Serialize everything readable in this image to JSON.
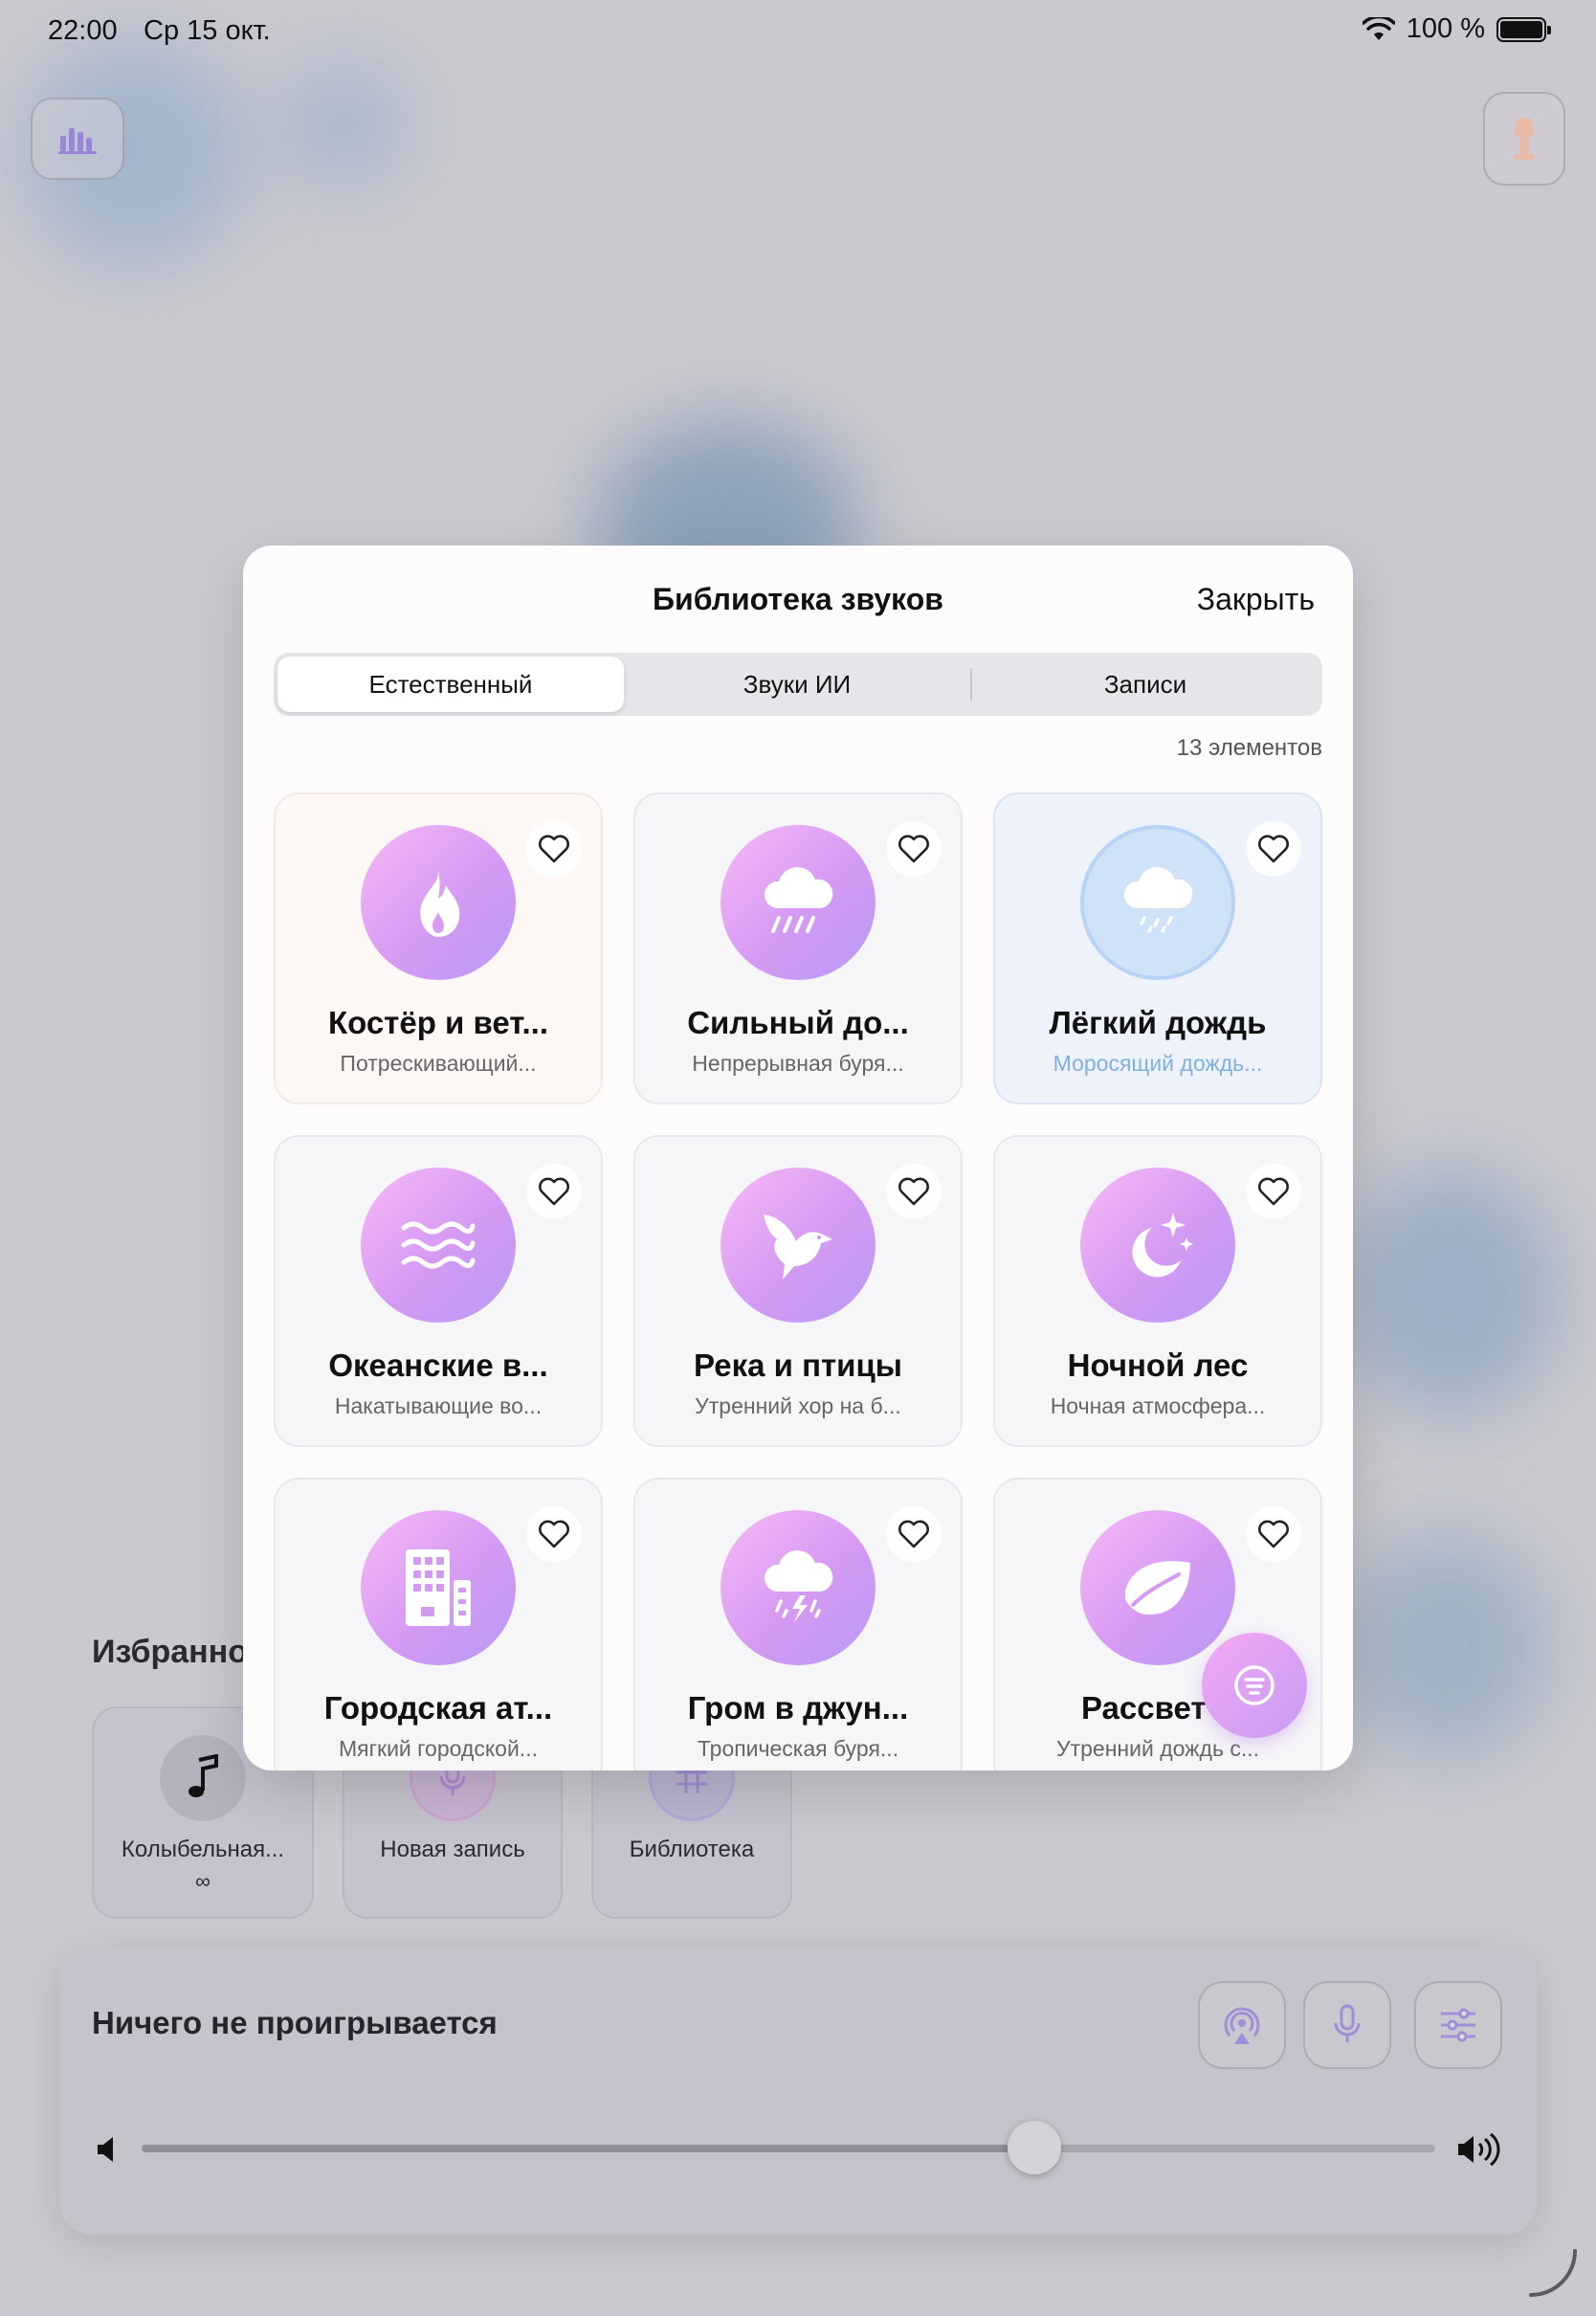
{
  "status_bar": {
    "time": "22:00",
    "date": "Ср 15 окт.",
    "battery": "100 %"
  },
  "background": {
    "favorites_title": "Избранное",
    "favorites": [
      {
        "label": "Колыбельная...",
        "sub": "∞",
        "icon": "music-note-icon"
      },
      {
        "label": "Новая запись",
        "icon": "microphone-icon"
      },
      {
        "label": "Библиотека",
        "icon": "grid-icon"
      }
    ],
    "player": {
      "now_playing": "Ничего не проигрывается",
      "volume": 0.69
    }
  },
  "modal": {
    "title": "Библиотека звуков",
    "close_label": "Закрыть",
    "tabs": [
      {
        "label": "Естественный",
        "active": true
      },
      {
        "label": "Звуки ИИ",
        "active": false
      },
      {
        "label": "Записи",
        "active": false
      }
    ],
    "count_label": "13 элементов",
    "items": [
      {
        "name": "Костёр и вет...",
        "desc": "Потрескивающий...",
        "icon": "fire-icon"
      },
      {
        "name": "Сильный до...",
        "desc": "Непрерывная буря...",
        "icon": "heavy-rain-icon"
      },
      {
        "name": "Лёгкий дождь",
        "desc": "Моросящий дождь...",
        "icon": "light-rain-icon",
        "selected": true
      },
      {
        "name": "Океанские в...",
        "desc": "Накатывающие во...",
        "icon": "waves-icon"
      },
      {
        "name": "Река и птицы",
        "desc": "Утренний хор на б...",
        "icon": "bird-icon"
      },
      {
        "name": "Ночной лес",
        "desc": "Ночная атмосфера...",
        "icon": "moon-stars-icon"
      },
      {
        "name": "Городская ат...",
        "desc": "Мягкий городской...",
        "icon": "building-icon"
      },
      {
        "name": "Гром в джун...",
        "desc": "Тропическая буря...",
        "icon": "thunderstorm-icon"
      },
      {
        "name": "Рассвет в",
        "desc": "Утренний дождь с...",
        "icon": "leaf-icon"
      }
    ]
  },
  "colors": {
    "accent": "#c79bf4",
    "selected_text": "#7fb0e0"
  }
}
